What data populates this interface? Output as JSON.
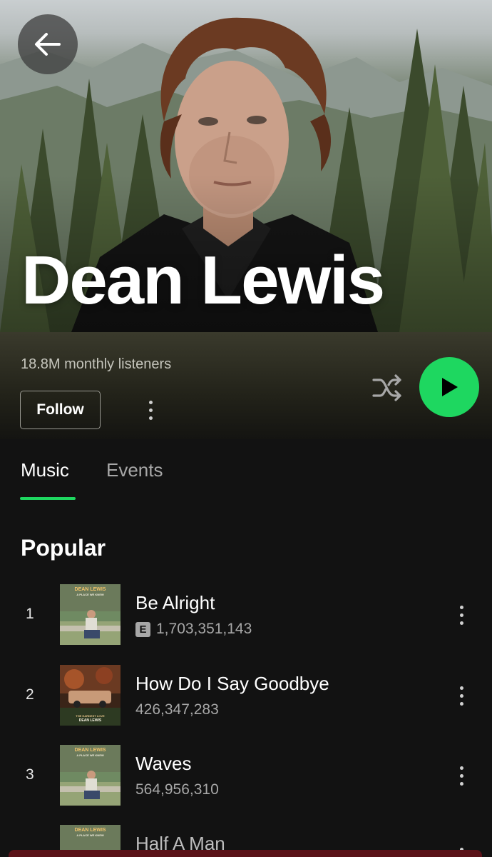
{
  "header": {
    "artist_name": "Dean Lewis",
    "back_icon": "arrow-left-icon"
  },
  "artist": {
    "monthly_listeners": "18.8M monthly listeners",
    "follow_label": "Follow",
    "more_icon": "more-vertical-icon",
    "shuffle_icon": "shuffle-icon",
    "play_icon": "play-icon",
    "accent_color": "#1ed760"
  },
  "tabs": [
    {
      "label": "Music",
      "active": true
    },
    {
      "label": "Events",
      "active": false
    }
  ],
  "popular": {
    "title": "Popular",
    "tracks": [
      {
        "rank": "1",
        "title": "Be Alright",
        "plays": "1,703,351,143",
        "explicit": true,
        "explicit_label": "E",
        "cover": {
          "line1": "DEAN LEWIS",
          "line2": "A PLACE WE KNEW"
        }
      },
      {
        "rank": "2",
        "title": "How Do I Say Goodbye",
        "plays": "426,347,283",
        "explicit": false,
        "cover": {
          "line1": "THE HARDEST LOVE",
          "line2": "DEAN LEWIS"
        }
      },
      {
        "rank": "3",
        "title": "Waves",
        "plays": "564,956,310",
        "explicit": false,
        "cover": {
          "line1": "DEAN LEWIS",
          "line2": "A PLACE WE KNEW"
        }
      },
      {
        "rank": "",
        "title": "Half A Man",
        "plays": "",
        "explicit": false,
        "cover": {
          "line1": "DEAN LEWIS",
          "line2": "A PLACE WE KNEW"
        }
      }
    ]
  }
}
